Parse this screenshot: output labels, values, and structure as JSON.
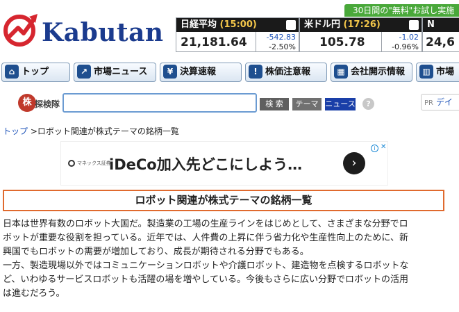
{
  "header": {
    "logo_text": "Kabutan",
    "promo_text": "30日間の\"無料\"お試し実施"
  },
  "quotes": [
    {
      "name": "日経平均",
      "time": "(15:00)",
      "value": "21,181.64",
      "change": "-542.83",
      "percent": "-2.50%"
    },
    {
      "name": "米ドル円",
      "time": "(17:26)",
      "value": "105.78",
      "change": "-1.02",
      "percent": "-0.96%"
    },
    {
      "name": "N",
      "time": "",
      "value": "24,6",
      "change": "",
      "percent": ""
    }
  ],
  "nav": {
    "items": [
      {
        "label": "トップ",
        "icon": "home-icon"
      },
      {
        "label": "市場ニュース",
        "icon": "chart-icon"
      },
      {
        "label": "決算速報",
        "icon": "yen-icon"
      },
      {
        "label": "株価注意報",
        "icon": "warning-icon"
      },
      {
        "label": "会社開示情報",
        "icon": "building-icon"
      },
      {
        "label": "市場",
        "icon": "market-icon"
      }
    ]
  },
  "search": {
    "icon_text": "株",
    "label": "探検隊",
    "value": "",
    "btn_search": "検 索",
    "btn_theme": "テーマ",
    "btn_news": "ニュース",
    "help": "?",
    "pr_tag": "PR",
    "pr_link": "デイ"
  },
  "breadcrumb": {
    "home": "トップ",
    "separator": ">",
    "current": "ロボット関連が株式テーマの銘柄一覧"
  },
  "ad": {
    "brand": "マネックス証券",
    "text": "iDeCo加入先どこにしよう…",
    "arrow": "›",
    "info": "i",
    "close": "✕"
  },
  "title": "ロボット関連が株式テーマの銘柄一覧",
  "body": {
    "para1_line1": "日本は世界有数のロボット大国だ。製造業の工場の生産ラインをはじめとして、さまざまな分野でロ",
    "para1_line2": "ボットが重要な役割を担っている。近年では、人件費の上昇に伴う省力化や生産性向上のために、新",
    "para1_line3": "興国でもロボットの需要が増加しており、成長が期待される分野でもある。",
    "para2_line1": "一方、製造現場以外ではコミュニケーションロボットや介護ロボット、建造物を点検するロボットな",
    "para2_line2": "ど、いわゆるサービスロボットも活躍の場を増やしている。今後もさらに広い分野でロボットの活用",
    "para2_line3": "は進むだろう。"
  },
  "colors": {
    "brand_blue": "#1b3b8e",
    "logo_red": "#d6262f",
    "promo_green": "#49a83a",
    "title_border": "#e06a2e",
    "change_blue": "#1c52b8"
  }
}
